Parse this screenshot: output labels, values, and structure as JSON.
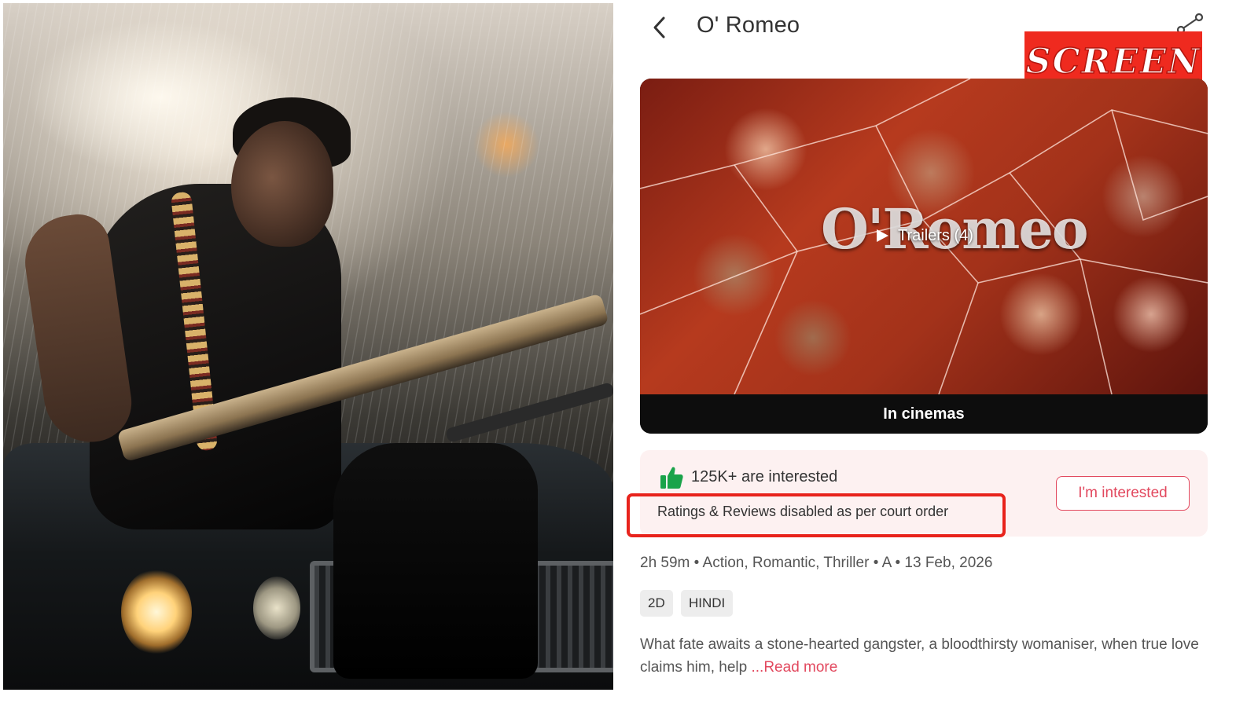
{
  "header": {
    "title": "O' Romeo"
  },
  "badge": {
    "text": "SCREEN",
    "color": "#ef2a1f"
  },
  "poster": {
    "logo_text": "O'Romeo",
    "trailer_label": "Trailers (4)",
    "status_label": "In cinemas"
  },
  "interest": {
    "count_text": "125K+ are interested",
    "court_order_text": "Ratings & Reviews disabled as per court order",
    "button_label": "I'm interested",
    "accent_color": "#e2485e",
    "highlight_color": "#e8231c"
  },
  "meta": {
    "line": "2h 59m • Action, Romantic, Thriller • A • 13 Feb, 2026"
  },
  "formats": [
    {
      "label": "2D"
    },
    {
      "label": "HINDI"
    }
  ],
  "synopsis": {
    "text": "What fate awaits a stone-hearted gangster, a bloodthirsty womaniser, when true love claims him, help ",
    "read_more": "...Read more"
  },
  "icons": {
    "back": "chevron-left-icon",
    "share": "share-icon",
    "play": "play-icon",
    "thumbs_up": "thumbs-up-icon"
  }
}
